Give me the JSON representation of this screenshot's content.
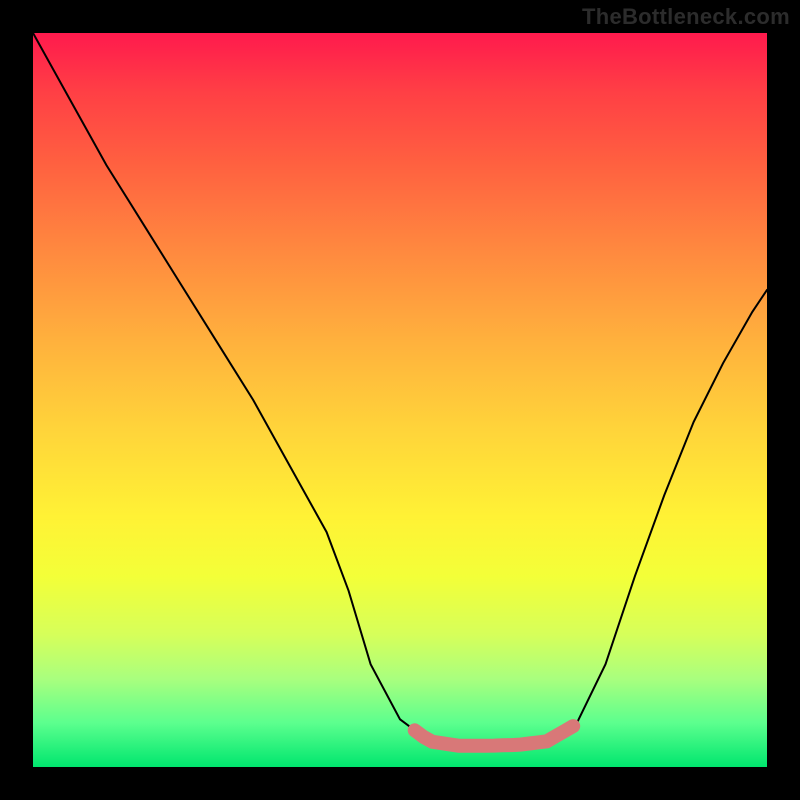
{
  "watermark": "TheBottleneck.com",
  "chart_data": {
    "type": "line",
    "title": "",
    "xlabel": "",
    "ylabel": "",
    "xlim": [
      0,
      100
    ],
    "ylim": [
      0,
      100
    ],
    "x": [
      0,
      5,
      10,
      15,
      20,
      25,
      30,
      35,
      40,
      43,
      46,
      50,
      54,
      58,
      62,
      66,
      70,
      74,
      78,
      82,
      86,
      90,
      94,
      98,
      100
    ],
    "y": [
      100,
      91,
      82,
      74,
      66,
      58,
      50,
      41,
      32,
      24,
      14,
      6.5,
      3.5,
      2.9,
      2.9,
      3.0,
      3.5,
      5.8,
      14,
      26,
      37,
      47,
      55,
      62,
      65
    ],
    "curve_color": "#000000",
    "highlight_band": {
      "x_start": 52,
      "x_end": 74,
      "color": "#d87878"
    },
    "background_gradient": {
      "orientation": "vertical",
      "stops": [
        {
          "pos": 0.0,
          "color": "#ff1a4d"
        },
        {
          "pos": 0.18,
          "color": "#ff6140"
        },
        {
          "pos": 0.42,
          "color": "#ffb13d"
        },
        {
          "pos": 0.66,
          "color": "#fff235"
        },
        {
          "pos": 0.88,
          "color": "#a9ff7e"
        },
        {
          "pos": 1.0,
          "color": "#00e66e"
        }
      ]
    }
  }
}
